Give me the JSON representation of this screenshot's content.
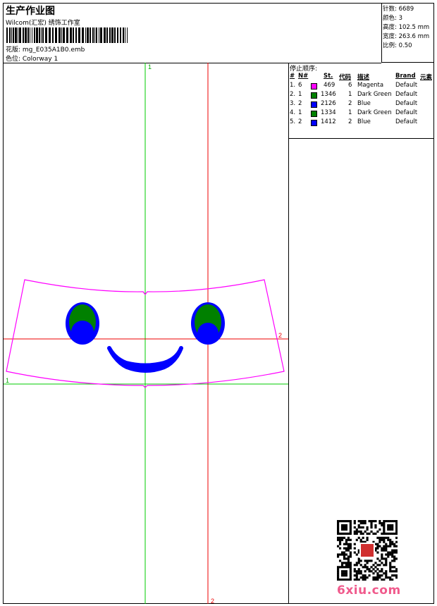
{
  "header": {
    "title": "生产作业图",
    "company": "Wilcom(汇宏) 绣饰工作室",
    "design": "花版: mg_E035A1B0.emb",
    "colorway": "色位: Colorway 1"
  },
  "stats": [
    {
      "label": "针数:",
      "value": "6689"
    },
    {
      "label": "颜色:",
      "value": "3"
    },
    {
      "label": "高度:",
      "value": "102.5 mm"
    },
    {
      "label": "宽度:",
      "value": "263.6 mm"
    },
    {
      "label": "比例:",
      "value": "0.50"
    }
  ],
  "stop_sequence": {
    "title": "停止顺序:",
    "headers": {
      "num": "#",
      "n": "N#",
      "st": "St.",
      "code": "代码",
      "desc": "描述",
      "brand": "Brand",
      "element": "元素"
    },
    "rows": [
      {
        "num": "1.",
        "n": "6",
        "color": "#ff00ff",
        "st": "469",
        "code": "6",
        "desc": "Magenta",
        "brand": "Default"
      },
      {
        "num": "2.",
        "n": "1",
        "color": "#008000",
        "st": "1346",
        "code": "1",
        "desc": "Dark Green",
        "brand": "Default"
      },
      {
        "num": "3.",
        "n": "2",
        "color": "#0000ff",
        "st": "2126",
        "code": "2",
        "desc": "Blue",
        "brand": "Default"
      },
      {
        "num": "4.",
        "n": "1",
        "color": "#008000",
        "st": "1334",
        "code": "1",
        "desc": "Dark Green",
        "brand": "Default"
      },
      {
        "num": "5.",
        "n": "2",
        "color": "#0000ff",
        "st": "1412",
        "code": "2",
        "desc": "Blue",
        "brand": "Default"
      }
    ]
  },
  "guides": {
    "green_top": "1",
    "green_left": "1",
    "red_right": "2",
    "red_bottom": "2"
  },
  "watermark": "6xiu.com",
  "colors": {
    "magenta": "#ff00ff",
    "green": "#008000",
    "blue": "#0000ff",
    "guide_green": "#00cc00",
    "guide_red": "#ee0000",
    "watermark": "#f05a8c"
  }
}
